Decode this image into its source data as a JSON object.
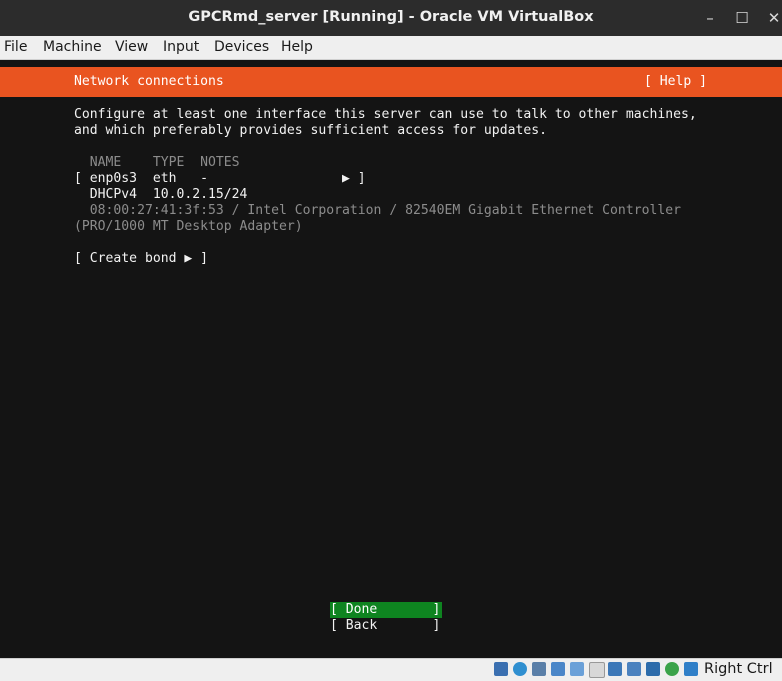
{
  "window": {
    "title": "GPCRmd_server [Running] - Oracle VM VirtualBox",
    "minimize_glyph": "–",
    "maximize_glyph": "☐",
    "close_glyph": "✕"
  },
  "menu": [
    "File",
    "Machine",
    "View",
    "Input",
    "Devices",
    "Help"
  ],
  "installer": {
    "header_title": "Network connections",
    "help_label": "[ Help ]",
    "description": [
      "Configure at least one interface this server can use to talk to other machines,",
      "and which preferably provides sufficient access for updates."
    ],
    "columns": "  NAME    TYPE  NOTES",
    "interface_row": "[ enp0s3  eth   -                 ▶ ]",
    "dhcp_row": "  DHCPv4  10.0.2.15/24",
    "mac_line": "  08:00:27:41:3f:53 / Intel Corporation / 82540EM Gigabit Ethernet Controller",
    "adapter_line": "(PRO/1000 MT Desktop Adapter)",
    "create_bond": "[ Create bond ▶ ]",
    "done_button": "[ Done       ]",
    "back_button": "[ Back       ]"
  },
  "statusbar": {
    "host_key": "Right Ctrl",
    "icons": [
      "hard-disk-icon",
      "optical-drive-icon",
      "audio-icon",
      "network-icon",
      "usb-icon",
      "shared-folders-icon",
      "display-icon",
      "video-capture-icon",
      "recording-icon",
      "virtualization-icon",
      "mouse-integration-icon",
      "keyboard-capture-icon"
    ]
  },
  "colors": {
    "accent": "#e95420",
    "done_bg": "#0e8420",
    "terminal_bg": "#141414"
  }
}
